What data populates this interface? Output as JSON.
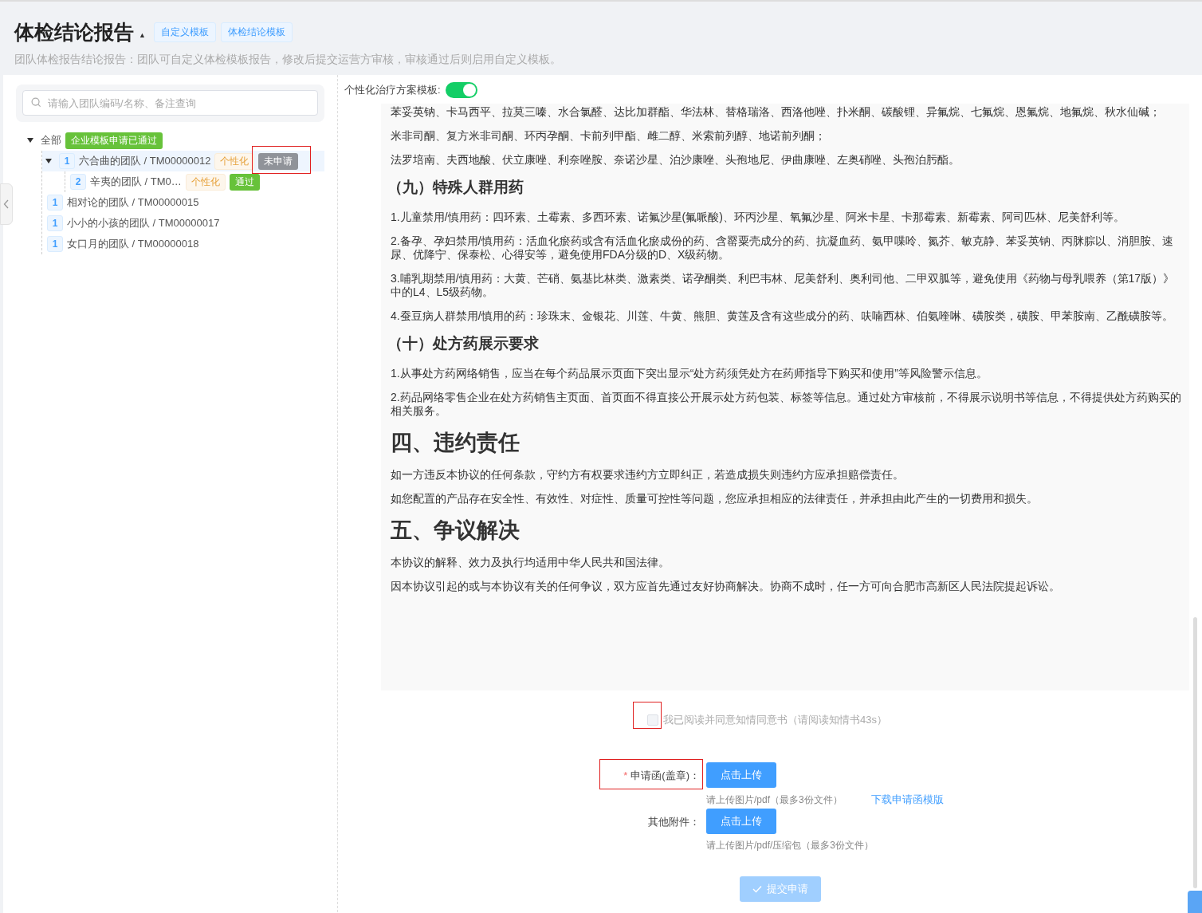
{
  "header": {
    "title": "体检结论报告",
    "collapse_icon": "▲",
    "tags": [
      "自定义模板",
      "体检结论模板"
    ],
    "description": "团队体检报告结论报告：团队可自定义体检模板报告，修改后提交运营方审核，审核通过后则启用自定义模板。"
  },
  "sidebar": {
    "search": {
      "placeholder": "请输入团队编码/名称、备注查询"
    },
    "tree": [
      {
        "label": "全部",
        "expanded": true,
        "selected": false,
        "tags": [
          {
            "text": "企业模板申请已通过",
            "kind": "success"
          }
        ],
        "children": [
          {
            "index": "1",
            "label": "六合曲的团队 / TM00000012",
            "expanded": true,
            "selected": true,
            "tags": [
              {
                "text": "个性化",
                "kind": "warning"
              },
              {
                "text": "未申请",
                "kind": "info"
              }
            ],
            "children": [
              {
                "index": "2",
                "label": "辛夷的团队 / TM0…",
                "selected": false,
                "tags": [
                  {
                    "text": "个性化",
                    "kind": "warning"
                  },
                  {
                    "text": "通过",
                    "kind": "success"
                  }
                ]
              }
            ]
          },
          {
            "index": "1",
            "label": "相对论的团队 / TM00000015",
            "selected": false
          },
          {
            "index": "1",
            "label": "小小的小孩的团队 / TM00000017",
            "selected": false
          },
          {
            "index": "1",
            "label": "女口月的团队 / TM00000018",
            "selected": false
          }
        ]
      }
    ]
  },
  "main": {
    "toggle": {
      "label": "个性化治疗方案模板:",
      "on": true
    },
    "document": [
      {
        "kind": "paragraph",
        "text": "苯妥英钠、卡马西平、拉莫三嗪、水合氯醛、达比加群酯、华法林、替格瑞洛、西洛他唑、扑米酮、碳酸锂、异氟烷、七氟烷、恩氟烷、地氟烷、秋水仙碱；"
      },
      {
        "kind": "paragraph",
        "text": "米非司酮、复方米非司酮、环丙孕酮、卡前列甲酯、雌二醇、米索前列醇、地诺前列酮；"
      },
      {
        "kind": "paragraph",
        "text": "法罗培南、夫西地酸、伏立康唑、利奈唑胺、奈诺沙星、泊沙康唑、头孢地尼、伊曲康唑、左奥硝唑、头孢泊肟酯。"
      },
      {
        "kind": "subheading",
        "text": "（九）特殊人群用药"
      },
      {
        "kind": "paragraph",
        "text": "1.儿童禁用/慎用药：四环素、土霉素、多西环素、诺氟沙星(氟哌酸)、环丙沙星、氧氟沙星、阿米卡星、卡那霉素、新霉素、阿司匹林、尼美舒利等。"
      },
      {
        "kind": "paragraph",
        "text": "2.备孕、孕妇禁用/慎用药：活血化瘀药或含有活血化瘀成份的药、含罂粟壳成分的药、抗凝血药、氨甲喋呤、氮芥、敏克静、苯妥英钠、丙脒腙以、消胆胺、速尿、优降宁、保泰松、心得安等，避免使用FDA分级的D、X级药物。"
      },
      {
        "kind": "paragraph",
        "text": "3.哺乳期禁用/慎用药：大黄、芒硝、氨基比林类、激素类、诺孕酮类、利巴韦林、尼美舒利、奥利司他、二甲双胍等，避免使用《药物与母乳喂养（第17版）》中的L4、L5级药物。"
      },
      {
        "kind": "paragraph",
        "text": "4.蚕豆病人群禁用/慎用的药：珍珠末、金银花、川莲、牛黄、熊胆、黄莲及含有这些成分的药、呋喃西林、伯氨喹啉、磺胺类，磺胺、甲苯胺南、乙酰磺胺等。"
      },
      {
        "kind": "subheading",
        "text": "（十）处方药展示要求"
      },
      {
        "kind": "paragraph",
        "text": "1.从事处方药网络销售，应当在每个药品展示页面下突出显示“处方药须凭处方在药师指导下购买和使用”等风险警示信息。"
      },
      {
        "kind": "paragraph",
        "text": "2.药品网络零售企业在处方药销售主页面、首页面不得直接公开展示处方药包装、标签等信息。通过处方审核前，不得展示说明书等信息，不得提供处方药购买的相关服务。"
      },
      {
        "kind": "heading",
        "text": "四、违约责任"
      },
      {
        "kind": "paragraph",
        "text": "如一方违反本协议的任何条款，守约方有权要求违约方立即纠正，若造成损失则违约方应承担赔偿责任。"
      },
      {
        "kind": "paragraph",
        "text": "如您配置的产品存在安全性、有效性、对症性、质量可控性等问题，您应承担相应的法律责任，并承担由此产生的一切费用和损失。"
      },
      {
        "kind": "heading",
        "text": "五、争议解决"
      },
      {
        "kind": "paragraph",
        "text": "本协议的解释、效力及执行均适用中华人民共和国法律。"
      },
      {
        "kind": "paragraph",
        "text": "因本协议引起的或与本协议有关的任何争议，双方应首先通过友好协商解决。协商不成时，任一方可向合肥市高新区人民法院提起诉讼。"
      }
    ],
    "agreement": {
      "checked": false,
      "disabled": true,
      "text": "我已阅读并同意知情同意书（请阅读知情书43s）"
    },
    "fields": [
      {
        "label": "申请函(盖章)：",
        "required_mark": "*",
        "button": "点击上传",
        "hint": "请上传图片/pdf（最多3份文件）",
        "link": "下载申请函模版"
      },
      {
        "label": "其他附件：",
        "button": "点击上传",
        "hint": "请上传图片/pdf/压缩包（最多3份文件）"
      }
    ],
    "submit": {
      "label": "提交申请",
      "disabled": true
    }
  }
}
